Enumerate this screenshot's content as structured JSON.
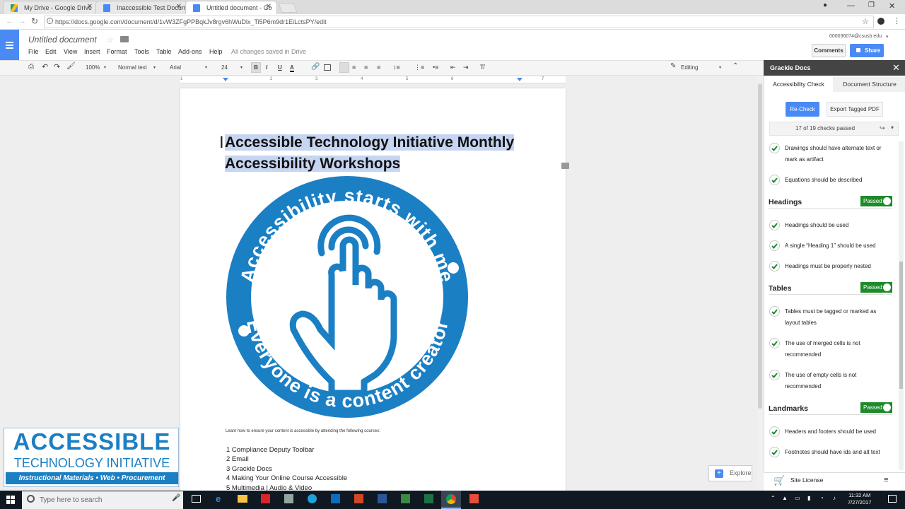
{
  "browser": {
    "tabs": [
      {
        "title": "My Drive - Google Drive",
        "icon": "google-drive-icon",
        "color": "#1a9f5a"
      },
      {
        "title": "Inaccessible Test Docume",
        "icon": "docs-icon",
        "color": "#4a8af4"
      },
      {
        "title": "Untitled document - Go",
        "icon": "docs-icon",
        "color": "#4a8af4"
      }
    ],
    "url": "https://docs.google.com/document/d/1vW3ZFgPPBqkJv8rgv6hWuDlx_Ti5P6m9dr1EiLctsPY/edit"
  },
  "docs": {
    "title": "Untitled document",
    "menu": [
      "File",
      "Edit",
      "View",
      "Insert",
      "Format",
      "Tools",
      "Table",
      "Add-ons",
      "Help"
    ],
    "saved_status": "All changes saved in Drive",
    "account": "000036074@csusb.edu",
    "comments_label": "Comments",
    "share_label": "Share",
    "toolbar": {
      "zoom": "100%",
      "style": "Normal text",
      "font": "Arial",
      "size": "24",
      "bold": "B",
      "italic": "I",
      "underline": "U",
      "text_color": "A",
      "mode": "Editing"
    },
    "ruler_numbers": [
      "1",
      "2",
      "3",
      "4",
      "5",
      "6",
      "7"
    ]
  },
  "document": {
    "heading_line1": "Accessible Technology Initiative Monthly",
    "heading_line2": "Accessibility Workshops",
    "logo_top_text": "Accessibility starts with me",
    "logo_bottom_text": "Everyone is a content creator",
    "intro": "Learn how to ensure your content is accessible by attending the following courses:",
    "list": [
      "1 Compliance Deputy Toolbar",
      "2 Email",
      "3 Grackle Docs",
      "4 Making Your Online Course Accessible",
      "5 Multimedia | Audio & Video"
    ]
  },
  "ati_logo": {
    "line1": "ACCESSIBLE",
    "line2": "TECHNOLOGY INITIATIVE",
    "line3": "Instructional Materials • Web • Procurement"
  },
  "explore_label": "Explore",
  "sidebar": {
    "title": "Grackle Docs",
    "tabs": [
      "Accessibility Check",
      "Document Structure"
    ],
    "recheck_label": "Re-Check",
    "export_label": "Export Tagged PDF",
    "checks_summary": "17 of 19 checks passed",
    "top_items": [
      "Drawings should have alternate text or mark as artifact",
      "Equations should be described"
    ],
    "sections": [
      {
        "name": "Headings",
        "status": "Passed",
        "items": [
          "Headings should be used",
          "A single “Heading 1” should be used",
          "Headings must be properly nested"
        ]
      },
      {
        "name": "Tables",
        "status": "Passed",
        "items": [
          "Tables must be tagged or marked as layout tables",
          "The use of merged cells is not recommended",
          "The use of empty cells is not recommended"
        ]
      },
      {
        "name": "Landmarks",
        "status": "Passed",
        "items": [
          "Headers and footers should be used",
          "Footnotes should have ids and alt text"
        ]
      }
    ],
    "site_license": "Site License"
  },
  "taskbar": {
    "search_placeholder": "Type here to search",
    "time": "11:32 AM",
    "date": "7/27/2017"
  },
  "colors": {
    "accent": "#4a8af4",
    "passed": "#1e8a2a",
    "logo_blue": "#1b7fc4",
    "selection": "#c6d5f1"
  }
}
